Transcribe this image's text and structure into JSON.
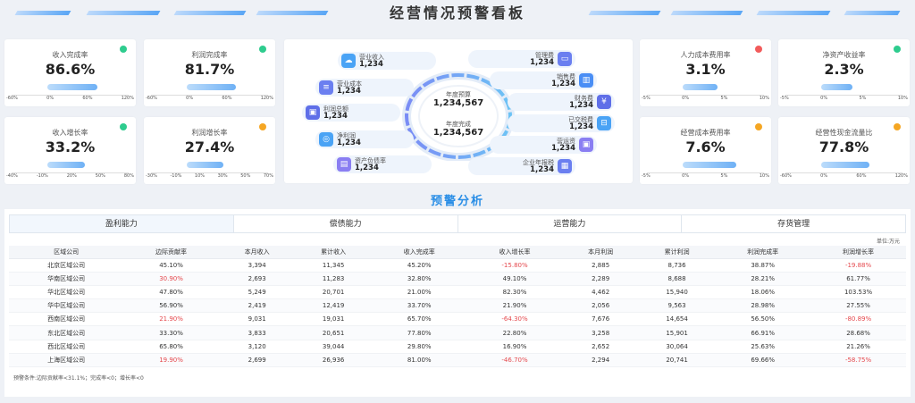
{
  "title": "经营情况预警看板",
  "kpis_left": [
    {
      "label": "收入完成率",
      "value": "86.6%",
      "status": "#2ecc8e",
      "ticks": [
        "-60%",
        "0%",
        "60%",
        "120%"
      ],
      "fill": 0.8
    },
    {
      "label": "利润完成率",
      "value": "81.7%",
      "status": "#2ecc8e",
      "ticks": [
        "-60%",
        "0%",
        "60%",
        "120%"
      ],
      "fill": 0.78
    },
    {
      "label": "收入增长率",
      "value": "33.2%",
      "status": "#2ecc8e",
      "ticks": [
        "-40%",
        "-10%",
        "20%",
        "50%",
        "80%"
      ],
      "fill": 0.6
    },
    {
      "label": "利润增长率",
      "value": "27.4%",
      "status": "#f5a623",
      "ticks": [
        "-30%",
        "-10%",
        "10%",
        "30%",
        "50%",
        "70%"
      ],
      "fill": 0.58
    }
  ],
  "kpis_right": [
    {
      "label": "人力成本费用率",
      "value": "3.1%",
      "status": "#f25b5b",
      "ticks": [
        "-5%",
        "0%",
        "5%",
        "10%"
      ],
      "fill": 0.55
    },
    {
      "label": "净资产收益率",
      "value": "2.3%",
      "status": "#2ecc8e",
      "ticks": [
        "-5%",
        "0%",
        "5%",
        "10%"
      ],
      "fill": 0.5
    },
    {
      "label": "经营成本费用率",
      "value": "7.6%",
      "status": "#f5a623",
      "ticks": [
        "-5%",
        "0%",
        "5%",
        "10%"
      ],
      "fill": 0.85
    },
    {
      "label": "经营性现金流量比",
      "value": "77.8%",
      "status": "#f5a623",
      "ticks": [
        "-60%",
        "0%",
        "60%",
        "120%"
      ],
      "fill": 0.77
    }
  ],
  "center": {
    "budget_label": "年度预算",
    "budget_value": "1,234,567",
    "actual_label": "年度完成",
    "actual_value": "1,234,567",
    "left_items": [
      {
        "label": "营业收入",
        "value": "1,234",
        "icon": "cloud-icon",
        "color": "#4aa3f5"
      },
      {
        "label": "营业成本",
        "value": "1,234",
        "icon": "list-icon",
        "color": "#6b7ff0"
      },
      {
        "label": "利润总额",
        "value": "1,234",
        "icon": "wallet-icon",
        "color": "#5f6fe8"
      },
      {
        "label": "净利润",
        "value": "1,234",
        "icon": "coin-icon",
        "color": "#4aa3f5"
      },
      {
        "label": "资产负债率",
        "value": "1,234",
        "icon": "stack-icon",
        "color": "#8a7ef2"
      }
    ],
    "right_items": [
      {
        "label": "管理费",
        "value": "1,234",
        "icon": "card-icon",
        "color": "#6b7ff0"
      },
      {
        "label": "销售费",
        "value": "1,234",
        "icon": "chart-icon",
        "color": "#4a8ef5"
      },
      {
        "label": "财务费",
        "value": "1,234",
        "icon": "money-icon",
        "color": "#5f6fe8"
      },
      {
        "label": "已交税费",
        "value": "1,234",
        "icon": "tax-icon",
        "color": "#4aa3f5"
      },
      {
        "label": "营运资",
        "value": "1,234",
        "icon": "wallet-icon",
        "color": "#8a7ef2"
      },
      {
        "label": "企业年报税",
        "value": "1,234",
        "icon": "report-icon",
        "color": "#6b7ff0"
      }
    ]
  },
  "section_title": "预警分析",
  "tabs": [
    "盈利能力",
    "偿债能力",
    "运营能力",
    "存货管理"
  ],
  "unit": "单位:万元",
  "table": {
    "headers": [
      "区域公司",
      "边际贡献率",
      "本月收入",
      "累计收入",
      "收入完成率",
      "收入增长率",
      "本月利润",
      "累计利润",
      "利润完成率",
      "利润增长率"
    ],
    "rows": [
      [
        "北京区域公司",
        "45.10%",
        "3,394",
        "11,345",
        "45.20%",
        "-15.80%",
        "2,885",
        "8,736",
        "38.87%",
        "-19.88%"
      ],
      [
        "华南区域公司",
        "30.90%",
        "2,693",
        "11,283",
        "32.80%",
        "49.10%",
        "2,289",
        "8,688",
        "28.21%",
        "61.77%"
      ],
      [
        "华北区域公司",
        "47.80%",
        "5,249",
        "20,701",
        "21.00%",
        "82.30%",
        "4,462",
        "15,940",
        "18.06%",
        "103.53%"
      ],
      [
        "华中区域公司",
        "56.90%",
        "2,419",
        "12,419",
        "33.70%",
        "21.90%",
        "2,056",
        "9,563",
        "28.98%",
        "27.55%"
      ],
      [
        "西南区域公司",
        "21.90%",
        "9,031",
        "19,031",
        "65.70%",
        "-64.30%",
        "7,676",
        "14,654",
        "56.50%",
        "-80.89%"
      ],
      [
        "东北区域公司",
        "33.30%",
        "3,833",
        "20,651",
        "77.80%",
        "22.80%",
        "3,258",
        "15,901",
        "66.91%",
        "28.68%"
      ],
      [
        "西北区域公司",
        "65.80%",
        "3,120",
        "39,044",
        "29.80%",
        "16.90%",
        "2,652",
        "30,064",
        "25.63%",
        "21.26%"
      ],
      [
        "上海区域公司",
        "19.90%",
        "2,699",
        "26,936",
        "81.00%",
        "-46.70%",
        "2,294",
        "20,741",
        "69.66%",
        "-58.75%"
      ]
    ],
    "alert_cells": [
      [
        0,
        5
      ],
      [
        0,
        9
      ],
      [
        1,
        1
      ],
      [
        4,
        1
      ],
      [
        4,
        5
      ],
      [
        4,
        9
      ],
      [
        7,
        1
      ],
      [
        7,
        5
      ],
      [
        7,
        9
      ]
    ]
  },
  "condition": "预警条件:边际贡献率<31.1%；完成率<0；增长率<0"
}
